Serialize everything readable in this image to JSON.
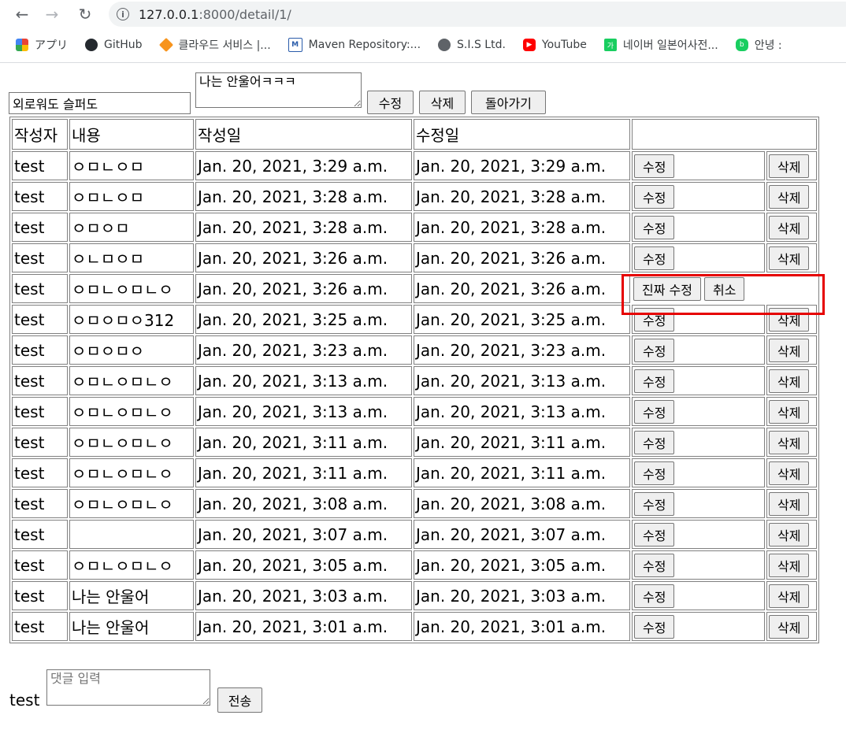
{
  "browser": {
    "url_host": "127.0.0.1",
    "url_rest": ":8000/detail/1/",
    "bookmarks": [
      {
        "label": "アプリ",
        "icon": "apps-grid-icon"
      },
      {
        "label": "GitHub",
        "icon": "github-icon"
      },
      {
        "label": "클라우드 서비스 |...",
        "icon": "cloud-cube-icon"
      },
      {
        "label": "Maven Repository:...",
        "icon": "maven-icon"
      },
      {
        "label": "S.I.S Ltd.",
        "icon": "globe-icon"
      },
      {
        "label": "YouTube",
        "icon": "youtube-icon"
      },
      {
        "label": "네이버 일본어사전...",
        "icon": "naver-dict-icon"
      },
      {
        "label": "안녕 :",
        "icon": "blog-icon"
      }
    ]
  },
  "edit_form": {
    "title_value": "외로워도 슬퍼도",
    "body_value": "나는 안울어ㅋㅋㅋ",
    "edit_label": "수정",
    "delete_label": "삭제",
    "back_label": "돌아가기"
  },
  "table": {
    "headers": [
      "작성자",
      "내용",
      "작성일",
      "수정일"
    ],
    "edit_label": "수정",
    "delete_label": "삭제",
    "confirm_edit_label": "진짜 수정",
    "cancel_label": "취소",
    "rows": [
      {
        "author": "test",
        "content": "ㅇㅁㄴㅇㅁ",
        "created": "Jan. 20, 2021, 3:29 a.m.",
        "updated": "Jan. 20, 2021, 3:29 a.m.",
        "editing": false
      },
      {
        "author": "test",
        "content": "ㅇㅁㄴㅇㅁ",
        "created": "Jan. 20, 2021, 3:28 a.m.",
        "updated": "Jan. 20, 2021, 3:28 a.m.",
        "editing": false
      },
      {
        "author": "test",
        "content": "ㅇㅁㅇㅁ",
        "created": "Jan. 20, 2021, 3:28 a.m.",
        "updated": "Jan. 20, 2021, 3:28 a.m.",
        "editing": false
      },
      {
        "author": "test",
        "content": "ㅇㄴㅁㅇㅁ",
        "created": "Jan. 20, 2021, 3:26 a.m.",
        "updated": "Jan. 20, 2021, 3:26 a.m.",
        "editing": false
      },
      {
        "author": "test",
        "content": "ㅇㅁㄴㅇㅁㄴㅇ",
        "created": "Jan. 20, 2021, 3:26 a.m.",
        "updated": "Jan. 20, 2021, 3:26 a.m.",
        "editing": true
      },
      {
        "author": "test",
        "content": "ㅇㅁㅇㅁㅇ312",
        "created": "Jan. 20, 2021, 3:25 a.m.",
        "updated": "Jan. 20, 2021, 3:25 a.m.",
        "editing": false
      },
      {
        "author": "test",
        "content": "ㅇㅁㅇㅁㅇ",
        "created": "Jan. 20, 2021, 3:23 a.m.",
        "updated": "Jan. 20, 2021, 3:23 a.m.",
        "editing": false
      },
      {
        "author": "test",
        "content": "ㅇㅁㄴㅇㅁㄴㅇ",
        "created": "Jan. 20, 2021, 3:13 a.m.",
        "updated": "Jan. 20, 2021, 3:13 a.m.",
        "editing": false
      },
      {
        "author": "test",
        "content": "ㅇㅁㄴㅇㅁㄴㅇ",
        "created": "Jan. 20, 2021, 3:13 a.m.",
        "updated": "Jan. 20, 2021, 3:13 a.m.",
        "editing": false
      },
      {
        "author": "test",
        "content": "ㅇㅁㄴㅇㅁㄴㅇ",
        "created": "Jan. 20, 2021, 3:11 a.m.",
        "updated": "Jan. 20, 2021, 3:11 a.m.",
        "editing": false
      },
      {
        "author": "test",
        "content": "ㅇㅁㄴㅇㅁㄴㅇ",
        "created": "Jan. 20, 2021, 3:11 a.m.",
        "updated": "Jan. 20, 2021, 3:11 a.m.",
        "editing": false
      },
      {
        "author": "test",
        "content": "ㅇㅁㄴㅇㅁㄴㅇ",
        "created": "Jan. 20, 2021, 3:08 a.m.",
        "updated": "Jan. 20, 2021, 3:08 a.m.",
        "editing": false
      },
      {
        "author": "test",
        "content": "",
        "created": "Jan. 20, 2021, 3:07 a.m.",
        "updated": "Jan. 20, 2021, 3:07 a.m.",
        "editing": false
      },
      {
        "author": "test",
        "content": "ㅇㅁㄴㅇㅁㄴㅇ",
        "created": "Jan. 20, 2021, 3:05 a.m.",
        "updated": "Jan. 20, 2021, 3:05 a.m.",
        "editing": false
      },
      {
        "author": "test",
        "content": "나는 안울어",
        "created": "Jan. 20, 2021, 3:03 a.m.",
        "updated": "Jan. 20, 2021, 3:03 a.m.",
        "editing": false
      },
      {
        "author": "test",
        "content": "나는 안울어",
        "created": "Jan. 20, 2021, 3:01 a.m.",
        "updated": "Jan. 20, 2021, 3:01 a.m.",
        "editing": false
      }
    ]
  },
  "comment_form": {
    "user": "test",
    "placeholder": "댓글 입력",
    "submit_label": "전송"
  },
  "colors": {
    "highlight": "#e60000",
    "button_bg": "#efefef"
  }
}
